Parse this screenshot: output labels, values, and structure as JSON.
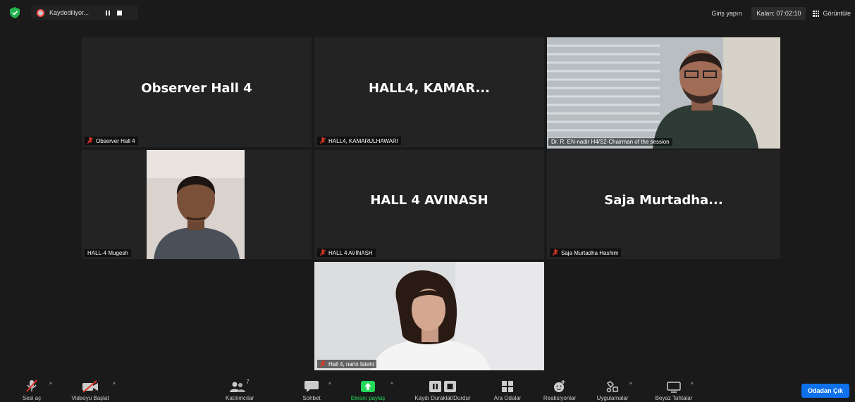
{
  "top": {
    "recording_label": "Kaydediliyor...",
    "signin": "Giriş yapın",
    "timer": "Kalan: 07:02:10",
    "view": "Görüntüle"
  },
  "tiles": {
    "observer": {
      "name": "Observer Hall 4",
      "label": "Observer Hall 4"
    },
    "kamar": {
      "name": "HALL4, KAMAR...",
      "label": "HALL4, KAMARULHAWARI"
    },
    "chair": {
      "label": "Dr. R. EN-nadir H4/S2-Chairman of the session"
    },
    "mugesh": {
      "label": "HALL-4 Mugesh"
    },
    "avinash": {
      "name": "HALL 4 AVINASH",
      "label": "HALL 4 AVINASH"
    },
    "saja": {
      "name": "Saja Murtadha...",
      "label": "Saja Murtadha Hashim"
    },
    "narin": {
      "label": "Hall 4, narin fatehi"
    }
  },
  "toolbar": {
    "mute": "Sesi aç",
    "video": "Videoyu Başlat",
    "participants": "Katılımcılar",
    "participants_count": "7",
    "chat": "Sohbet",
    "share": "Ekranı paylaş",
    "record": "Kaydı Duraklat/Durdur",
    "breakout": "Ara Odalar",
    "reactions": "Reaksiyonlar",
    "apps": "Uygulamalar",
    "whiteboard": "Beyaz Tahtalar",
    "leave": "Odadan Çık"
  },
  "colors": {
    "accent_blue": "#0e71eb",
    "share_green": "#23d959",
    "active_speaker": "#d5e65a",
    "muted_red": "#e0372b"
  }
}
